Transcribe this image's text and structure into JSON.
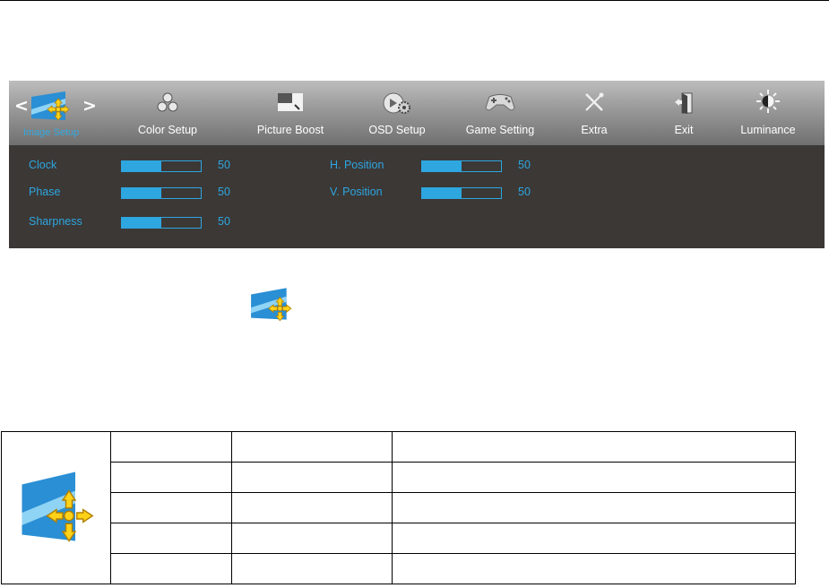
{
  "osd": {
    "active_tab_label": "Image Setup",
    "tabs": [
      {
        "label": "Color Setup",
        "icon": "color-setup-icon"
      },
      {
        "label": "Picture Boost",
        "icon": "picture-boost-icon"
      },
      {
        "label": "OSD Setup",
        "icon": "osd-setup-icon"
      },
      {
        "label": "Game Setting",
        "icon": "game-setting-icon"
      },
      {
        "label": "Extra",
        "icon": "extra-icon"
      },
      {
        "label": "Exit",
        "icon": "exit-icon"
      },
      {
        "label": "Luminance",
        "icon": "luminance-icon"
      }
    ],
    "nav_left": "<",
    "nav_right": ">",
    "settings": [
      {
        "label": "Clock",
        "value": "50",
        "level": 0.5
      },
      {
        "label": "Phase",
        "value": "50",
        "level": 0.5
      },
      {
        "label": "Sharpness",
        "value": "50",
        "level": 0.5
      },
      {
        "label": "H. Position",
        "value": "50",
        "level": 0.5
      },
      {
        "label": "V. Position",
        "value": "50",
        "level": 0.5
      }
    ]
  },
  "colors": {
    "accent": "#2ea6e0",
    "panel": "#3b3836",
    "header_top": "#bdbdbd",
    "header_bottom": "#707070"
  },
  "table": {
    "rows": [
      [
        "",
        "",
        ""
      ],
      [
        "",
        "",
        ""
      ],
      [
        "",
        "",
        ""
      ],
      [
        "",
        "",
        ""
      ],
      [
        "",
        "",
        ""
      ]
    ]
  }
}
